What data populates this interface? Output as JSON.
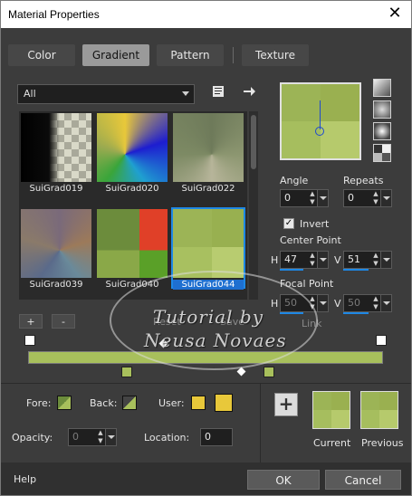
{
  "window": {
    "title": "Material Properties",
    "close_glyph": "✕"
  },
  "tabs": [
    {
      "label": "Color",
      "active": false
    },
    {
      "label": "Gradient",
      "active": true
    },
    {
      "label": "Pattern",
      "active": false
    },
    {
      "label": "Texture",
      "active": false
    }
  ],
  "category": {
    "value": "All"
  },
  "icons": {
    "library": "book-icon",
    "arrow": "right-arrow-icon"
  },
  "gallery": [
    {
      "label": "SuiGrad019",
      "selected": false
    },
    {
      "label": "SuiGrad020",
      "selected": false
    },
    {
      "label": "SuiGrad022",
      "selected": false
    },
    {
      "label": "SuiGrad039",
      "selected": false
    },
    {
      "label": "SuiGrad040",
      "selected": false
    },
    {
      "label": "SuiGrad044",
      "selected": true
    }
  ],
  "gallery_buttons": {
    "add": "+",
    "remove": "-",
    "reset": "Reset",
    "save": "Save",
    "link": "Link"
  },
  "angle": {
    "label": "Angle",
    "value": "0"
  },
  "repeats": {
    "label": "Repeats",
    "value": "0"
  },
  "invert": {
    "label": "Invert",
    "checked": true
  },
  "center_point": {
    "label": "Center Point",
    "h_label": "H",
    "h_value": "47",
    "v_label": "V",
    "v_value": "51"
  },
  "focal_point": {
    "label": "Focal Point",
    "h_label": "H",
    "h_value": "50",
    "v_label": "V",
    "v_value": "50"
  },
  "stops": {
    "fore_label": "Fore:",
    "back_label": "Back:",
    "user_label": "User:",
    "opacity_label": "Opacity:",
    "opacity_value": "0",
    "location_label": "Location:",
    "location_value": "0",
    "user_color": "#e8c83a"
  },
  "swatches": {
    "current_label": "Current",
    "previous_label": "Previous",
    "color": "#a8c05c"
  },
  "footer": {
    "help": "Help",
    "ok": "OK",
    "cancel": "Cancel"
  },
  "watermark": {
    "line1": "Tutorial by",
    "line2": "Neusa Novaes"
  }
}
